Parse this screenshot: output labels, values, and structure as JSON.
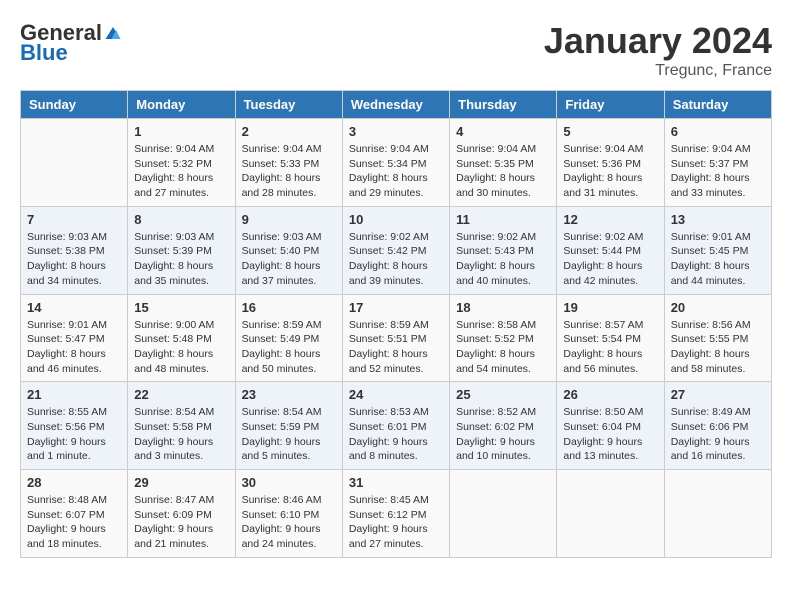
{
  "header": {
    "logo_general": "General",
    "logo_blue": "Blue",
    "month_title": "January 2024",
    "location": "Tregunc, France"
  },
  "weekdays": [
    "Sunday",
    "Monday",
    "Tuesday",
    "Wednesday",
    "Thursday",
    "Friday",
    "Saturday"
  ],
  "weeks": [
    [
      {
        "day": "",
        "info": ""
      },
      {
        "day": "1",
        "info": "Sunrise: 9:04 AM\nSunset: 5:32 PM\nDaylight: 8 hours\nand 27 minutes."
      },
      {
        "day": "2",
        "info": "Sunrise: 9:04 AM\nSunset: 5:33 PM\nDaylight: 8 hours\nand 28 minutes."
      },
      {
        "day": "3",
        "info": "Sunrise: 9:04 AM\nSunset: 5:34 PM\nDaylight: 8 hours\nand 29 minutes."
      },
      {
        "day": "4",
        "info": "Sunrise: 9:04 AM\nSunset: 5:35 PM\nDaylight: 8 hours\nand 30 minutes."
      },
      {
        "day": "5",
        "info": "Sunrise: 9:04 AM\nSunset: 5:36 PM\nDaylight: 8 hours\nand 31 minutes."
      },
      {
        "day": "6",
        "info": "Sunrise: 9:04 AM\nSunset: 5:37 PM\nDaylight: 8 hours\nand 33 minutes."
      }
    ],
    [
      {
        "day": "7",
        "info": "Sunrise: 9:03 AM\nSunset: 5:38 PM\nDaylight: 8 hours\nand 34 minutes."
      },
      {
        "day": "8",
        "info": "Sunrise: 9:03 AM\nSunset: 5:39 PM\nDaylight: 8 hours\nand 35 minutes."
      },
      {
        "day": "9",
        "info": "Sunrise: 9:03 AM\nSunset: 5:40 PM\nDaylight: 8 hours\nand 37 minutes."
      },
      {
        "day": "10",
        "info": "Sunrise: 9:02 AM\nSunset: 5:42 PM\nDaylight: 8 hours\nand 39 minutes."
      },
      {
        "day": "11",
        "info": "Sunrise: 9:02 AM\nSunset: 5:43 PM\nDaylight: 8 hours\nand 40 minutes."
      },
      {
        "day": "12",
        "info": "Sunrise: 9:02 AM\nSunset: 5:44 PM\nDaylight: 8 hours\nand 42 minutes."
      },
      {
        "day": "13",
        "info": "Sunrise: 9:01 AM\nSunset: 5:45 PM\nDaylight: 8 hours\nand 44 minutes."
      }
    ],
    [
      {
        "day": "14",
        "info": "Sunrise: 9:01 AM\nSunset: 5:47 PM\nDaylight: 8 hours\nand 46 minutes."
      },
      {
        "day": "15",
        "info": "Sunrise: 9:00 AM\nSunset: 5:48 PM\nDaylight: 8 hours\nand 48 minutes."
      },
      {
        "day": "16",
        "info": "Sunrise: 8:59 AM\nSunset: 5:49 PM\nDaylight: 8 hours\nand 50 minutes."
      },
      {
        "day": "17",
        "info": "Sunrise: 8:59 AM\nSunset: 5:51 PM\nDaylight: 8 hours\nand 52 minutes."
      },
      {
        "day": "18",
        "info": "Sunrise: 8:58 AM\nSunset: 5:52 PM\nDaylight: 8 hours\nand 54 minutes."
      },
      {
        "day": "19",
        "info": "Sunrise: 8:57 AM\nSunset: 5:54 PM\nDaylight: 8 hours\nand 56 minutes."
      },
      {
        "day": "20",
        "info": "Sunrise: 8:56 AM\nSunset: 5:55 PM\nDaylight: 8 hours\nand 58 minutes."
      }
    ],
    [
      {
        "day": "21",
        "info": "Sunrise: 8:55 AM\nSunset: 5:56 PM\nDaylight: 9 hours\nand 1 minute."
      },
      {
        "day": "22",
        "info": "Sunrise: 8:54 AM\nSunset: 5:58 PM\nDaylight: 9 hours\nand 3 minutes."
      },
      {
        "day": "23",
        "info": "Sunrise: 8:54 AM\nSunset: 5:59 PM\nDaylight: 9 hours\nand 5 minutes."
      },
      {
        "day": "24",
        "info": "Sunrise: 8:53 AM\nSunset: 6:01 PM\nDaylight: 9 hours\nand 8 minutes."
      },
      {
        "day": "25",
        "info": "Sunrise: 8:52 AM\nSunset: 6:02 PM\nDaylight: 9 hours\nand 10 minutes."
      },
      {
        "day": "26",
        "info": "Sunrise: 8:50 AM\nSunset: 6:04 PM\nDaylight: 9 hours\nand 13 minutes."
      },
      {
        "day": "27",
        "info": "Sunrise: 8:49 AM\nSunset: 6:06 PM\nDaylight: 9 hours\nand 16 minutes."
      }
    ],
    [
      {
        "day": "28",
        "info": "Sunrise: 8:48 AM\nSunset: 6:07 PM\nDaylight: 9 hours\nand 18 minutes."
      },
      {
        "day": "29",
        "info": "Sunrise: 8:47 AM\nSunset: 6:09 PM\nDaylight: 9 hours\nand 21 minutes."
      },
      {
        "day": "30",
        "info": "Sunrise: 8:46 AM\nSunset: 6:10 PM\nDaylight: 9 hours\nand 24 minutes."
      },
      {
        "day": "31",
        "info": "Sunrise: 8:45 AM\nSunset: 6:12 PM\nDaylight: 9 hours\nand 27 minutes."
      },
      {
        "day": "",
        "info": ""
      },
      {
        "day": "",
        "info": ""
      },
      {
        "day": "",
        "info": ""
      }
    ]
  ]
}
